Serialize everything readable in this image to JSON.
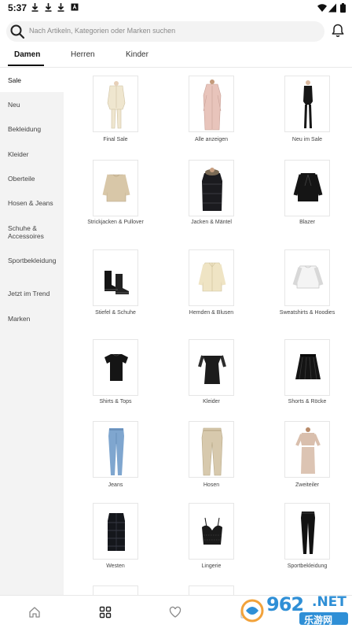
{
  "status": {
    "time": "5:37"
  },
  "search": {
    "placeholder": "Nach Artikeln, Kategorien oder Marken suchen"
  },
  "tabs": [
    {
      "label": "Damen",
      "active": true
    },
    {
      "label": "Herren",
      "active": false
    },
    {
      "label": "Kinder",
      "active": false
    }
  ],
  "sidebar": {
    "items": [
      {
        "label": "Sale",
        "active": true
      },
      {
        "label": "Neu"
      },
      {
        "label": "Bekleidung"
      },
      {
        "label": "Kleider"
      },
      {
        "label": "Oberteile"
      },
      {
        "label": "Hosen & Jeans"
      },
      {
        "label": "Schuhe & Accessoires"
      },
      {
        "label": "Sportbekleidung"
      },
      {
        "label": "Jetzt im Trend"
      },
      {
        "label": "Marken"
      }
    ]
  },
  "categories": [
    {
      "label": "Final Sale",
      "image": "cream-suit"
    },
    {
      "label": "Alle anzeigen",
      "image": "pink-coat"
    },
    {
      "label": "Neu im Sale",
      "image": "black-jumpsuit"
    },
    {
      "label": "Strickjacken & Pullover",
      "image": "beige-sweater"
    },
    {
      "label": "Jacken & Mäntel",
      "image": "black-puffer"
    },
    {
      "label": "Blazer",
      "image": "black-blazer"
    },
    {
      "label": "Stiefel & Schuhe",
      "image": "black-boots"
    },
    {
      "label": "Hemden & Blusen",
      "image": "cream-shirt"
    },
    {
      "label": "Sweatshirts & Hoodies",
      "image": "white-sweatshirt"
    },
    {
      "label": "Shirts & Tops",
      "image": "black-tshirt"
    },
    {
      "label": "Kleider",
      "image": "black-dress"
    },
    {
      "label": "Shorts & Röcke",
      "image": "black-skirt"
    },
    {
      "label": "Jeans",
      "image": "blue-jeans"
    },
    {
      "label": "Hosen",
      "image": "beige-trousers"
    },
    {
      "label": "Zweiteiler",
      "image": "beige-coord"
    },
    {
      "label": "Westen",
      "image": "black-vest"
    },
    {
      "label": "Lingerie",
      "image": "black-lace-bra"
    },
    {
      "label": "Sportbekleidung",
      "image": "black-leggings"
    }
  ],
  "bottom_nav": [
    {
      "icon": "home-icon"
    },
    {
      "icon": "categories-icon",
      "active": true
    },
    {
      "icon": "wishlist-icon"
    },
    {
      "icon": "bag-icon"
    }
  ],
  "watermark": {
    "text_logo": "962",
    "text_net": ".NET",
    "text_cn": "乐游网"
  },
  "colors": {
    "accent": "#111111",
    "sidebar_bg": "#f3f3f3",
    "watermark_blue": "#2f8fd6",
    "watermark_orange": "#f2a23a"
  }
}
